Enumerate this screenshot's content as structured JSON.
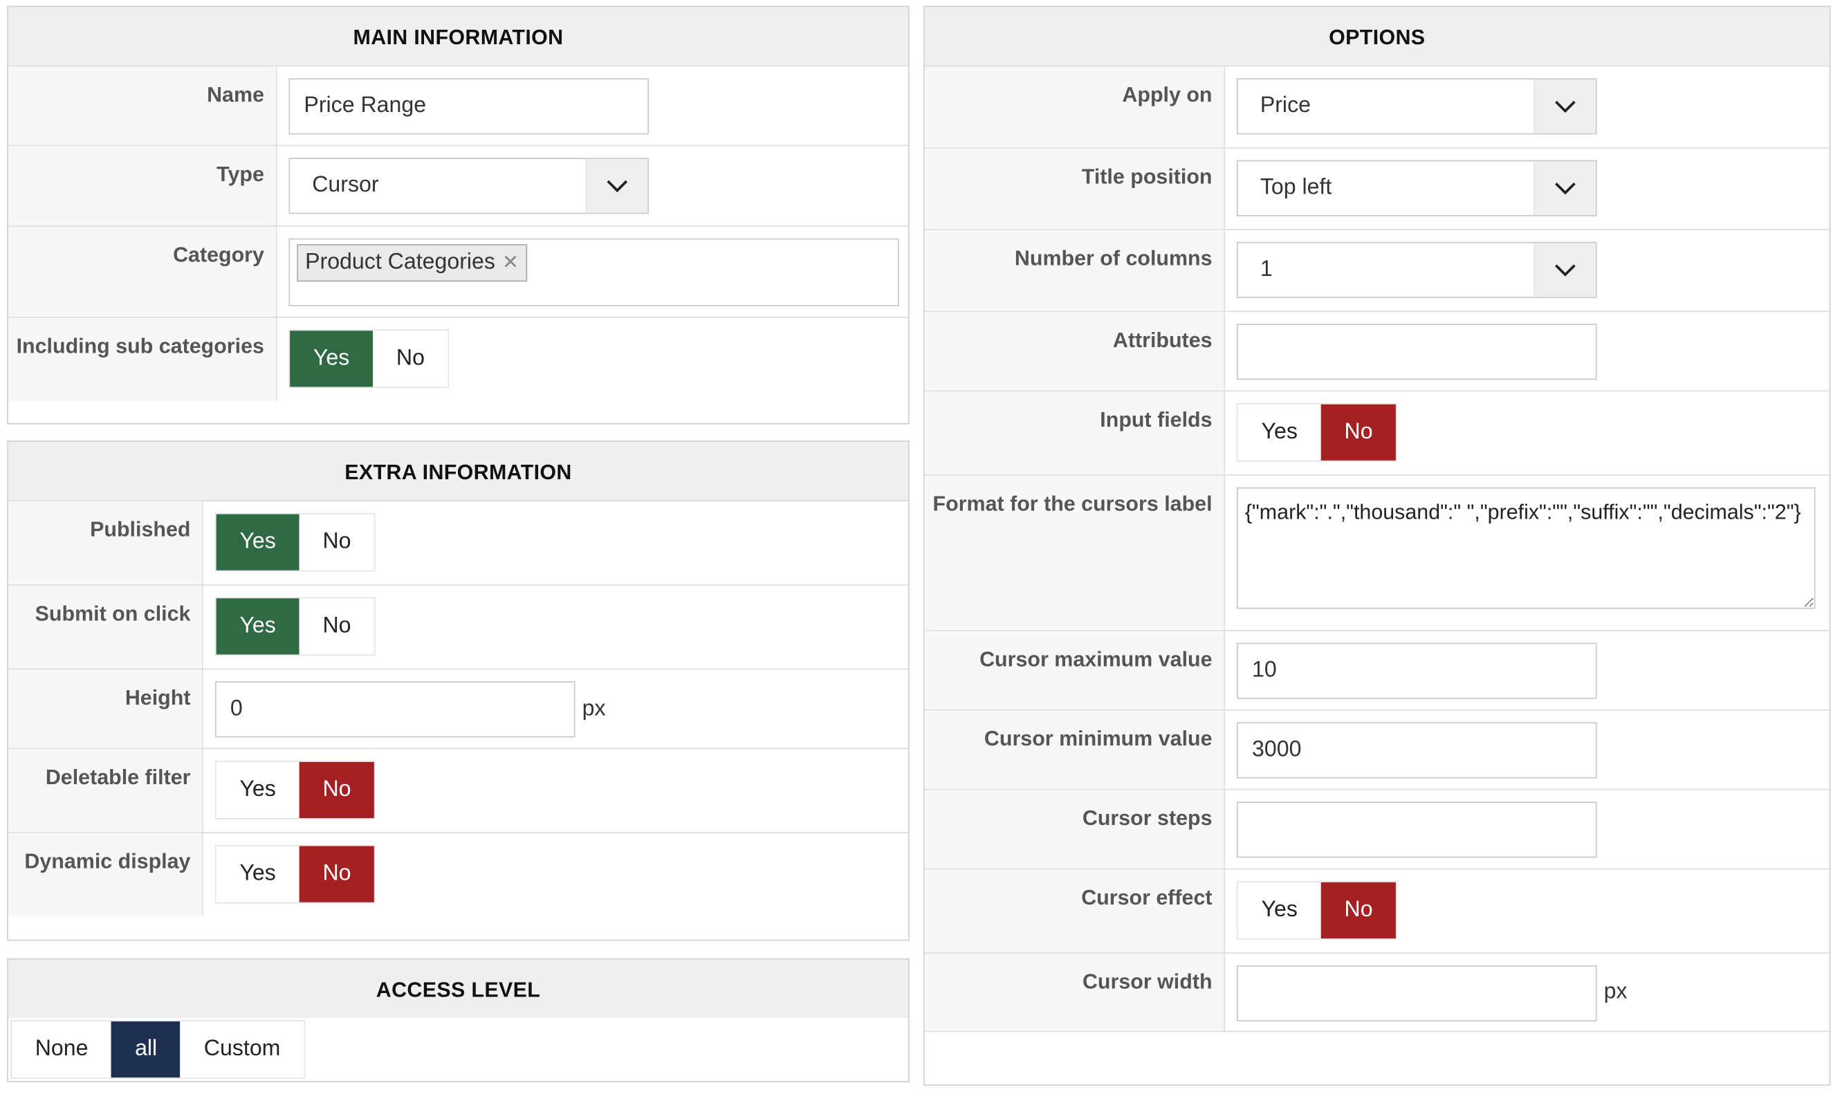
{
  "main": {
    "title": "MAIN INFORMATION",
    "name_label": "Name",
    "name_value": "Price Range",
    "type_label": "Type",
    "type_value": "Cursor",
    "category_label": "Category",
    "category_tag": "Product Categories",
    "including_label": "Including sub categories",
    "yes": "Yes",
    "no": "No",
    "including_selected": "Yes"
  },
  "extra": {
    "title": "EXTRA INFORMATION",
    "published_label": "Published",
    "submit_label": "Submit on click",
    "height_label": "Height",
    "height_value": "0",
    "height_unit": "px",
    "deletable_label": "Deletable filter",
    "dynamic_label": "Dynamic display",
    "yes": "Yes",
    "no": "No"
  },
  "access": {
    "title": "ACCESS LEVEL",
    "options": [
      "None",
      "all",
      "Custom"
    ],
    "selected": "all"
  },
  "options": {
    "title": "OPTIONS",
    "apply_label": "Apply on",
    "apply_value": "Price",
    "title_pos_label": "Title position",
    "title_pos_value": "Top left",
    "columns_label": "Number of columns",
    "columns_value": "1",
    "attributes_label": "Attributes",
    "attributes_value": "",
    "input_fields_label": "Input fields",
    "format_label": "Format for the cursors label",
    "format_value": "{\"mark\":\".\",\"thousand\":\" \",\"prefix\":\"\",\"suffix\":\"\",\"decimals\":\"2\"}",
    "max_label": "Cursor maximum value",
    "max_value": "10",
    "min_label": "Cursor minimum value",
    "min_value": "3000",
    "steps_label": "Cursor steps",
    "steps_value": "",
    "effect_label": "Cursor effect",
    "width_label": "Cursor width",
    "width_value": "",
    "width_unit": "px",
    "yes": "Yes",
    "no": "No"
  },
  "colors": {
    "yes_active": "#2f6a45",
    "no_active": "#a32023",
    "access_active": "#1e3050"
  }
}
